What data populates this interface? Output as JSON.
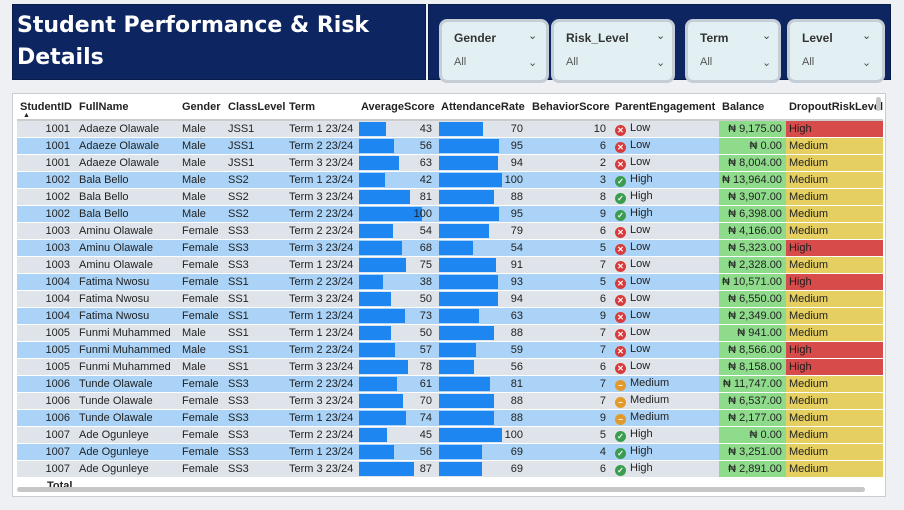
{
  "report": {
    "title": "Student Performance & Risk Details",
    "more_options": "..."
  },
  "slicers": [
    {
      "title": "Gender",
      "value": "All"
    },
    {
      "title": "Risk_Level",
      "value": "All"
    },
    {
      "title": "Term",
      "value": "All"
    },
    {
      "title": "Level",
      "value": "All"
    }
  ],
  "table": {
    "columns": [
      "StudentID",
      "FullName",
      "Gender",
      "ClassLevel",
      "Term",
      "AverageScore",
      "AttendanceRate",
      "BehaviorScore",
      "ParentEngagement",
      "Balance",
      "DropoutRiskLevel"
    ],
    "sorted_column": "StudentID",
    "rows": [
      {
        "StudentID": "1001",
        "FullName": "Adaeze Olawale",
        "Gender": "Male",
        "ClassLevel": "JSS1",
        "Term": "Term 1 23/24",
        "AverageScore": 43,
        "AttendanceRate": 70,
        "BehaviorScore": "10",
        "ParentEngagement": "Low",
        "Balance": "₦ 9,175.00",
        "DropoutRiskLevel": "High"
      },
      {
        "StudentID": "1001",
        "FullName": "Adaeze Olawale",
        "Gender": "Male",
        "ClassLevel": "JSS1",
        "Term": "Term 2 23/24",
        "AverageScore": 56,
        "AttendanceRate": 95,
        "BehaviorScore": "6",
        "ParentEngagement": "Low",
        "Balance": "₦ 0.00",
        "DropoutRiskLevel": "Medium"
      },
      {
        "StudentID": "1001",
        "FullName": "Adaeze Olawale",
        "Gender": "Male",
        "ClassLevel": "JSS1",
        "Term": "Term 3 23/24",
        "AverageScore": 63,
        "AttendanceRate": 94,
        "BehaviorScore": "2",
        "ParentEngagement": "Low",
        "Balance": "₦ 8,004.00",
        "DropoutRiskLevel": "Medium"
      },
      {
        "StudentID": "1002",
        "FullName": "Bala Bello",
        "Gender": "Male",
        "ClassLevel": "SS2",
        "Term": "Term 1 23/24",
        "AverageScore": 42,
        "AttendanceRate": 100,
        "BehaviorScore": "3",
        "ParentEngagement": "High",
        "Balance": "₦ 13,964.00",
        "DropoutRiskLevel": "Medium"
      },
      {
        "StudentID": "1002",
        "FullName": "Bala Bello",
        "Gender": "Male",
        "ClassLevel": "SS2",
        "Term": "Term 3 23/24",
        "AverageScore": 81,
        "AttendanceRate": 88,
        "BehaviorScore": "8",
        "ParentEngagement": "High",
        "Balance": "₦ 3,907.00",
        "DropoutRiskLevel": "Medium"
      },
      {
        "StudentID": "1002",
        "FullName": "Bala Bello",
        "Gender": "Male",
        "ClassLevel": "SS2",
        "Term": "Term 2 23/24",
        "AverageScore": 100,
        "AttendanceRate": 95,
        "BehaviorScore": "9",
        "ParentEngagement": "High",
        "Balance": "₦ 6,398.00",
        "DropoutRiskLevel": "Medium"
      },
      {
        "StudentID": "1003",
        "FullName": "Aminu Olawale",
        "Gender": "Female",
        "ClassLevel": "SS3",
        "Term": "Term 2 23/24",
        "AverageScore": 54,
        "AttendanceRate": 79,
        "BehaviorScore": "6",
        "ParentEngagement": "Low",
        "Balance": "₦ 4,166.00",
        "DropoutRiskLevel": "Medium"
      },
      {
        "StudentID": "1003",
        "FullName": "Aminu Olawale",
        "Gender": "Female",
        "ClassLevel": "SS3",
        "Term": "Term 3 23/24",
        "AverageScore": 68,
        "AttendanceRate": 54,
        "BehaviorScore": "5",
        "ParentEngagement": "Low",
        "Balance": "₦ 5,323.00",
        "DropoutRiskLevel": "High"
      },
      {
        "StudentID": "1003",
        "FullName": "Aminu Olawale",
        "Gender": "Female",
        "ClassLevel": "SS3",
        "Term": "Term 1 23/24",
        "AverageScore": 75,
        "AttendanceRate": 91,
        "BehaviorScore": "7",
        "ParentEngagement": "Low",
        "Balance": "₦ 2,328.00",
        "DropoutRiskLevel": "Medium"
      },
      {
        "StudentID": "1004",
        "FullName": "Fatima Nwosu",
        "Gender": "Female",
        "ClassLevel": "SS1",
        "Term": "Term 2 23/24",
        "AverageScore": 38,
        "AttendanceRate": 93,
        "BehaviorScore": "5",
        "ParentEngagement": "Low",
        "Balance": "₦ 10,571.00",
        "DropoutRiskLevel": "High"
      },
      {
        "StudentID": "1004",
        "FullName": "Fatima Nwosu",
        "Gender": "Female",
        "ClassLevel": "SS1",
        "Term": "Term 3 23/24",
        "AverageScore": 50,
        "AttendanceRate": 94,
        "BehaviorScore": "6",
        "ParentEngagement": "Low",
        "Balance": "₦ 6,550.00",
        "DropoutRiskLevel": "Medium"
      },
      {
        "StudentID": "1004",
        "FullName": "Fatima Nwosu",
        "Gender": "Female",
        "ClassLevel": "SS1",
        "Term": "Term 1 23/24",
        "AverageScore": 73,
        "AttendanceRate": 63,
        "BehaviorScore": "9",
        "ParentEngagement": "Low",
        "Balance": "₦ 2,349.00",
        "DropoutRiskLevel": "Medium"
      },
      {
        "StudentID": "1005",
        "FullName": "Funmi Muhammed",
        "Gender": "Male",
        "ClassLevel": "SS1",
        "Term": "Term 1 23/24",
        "AverageScore": 50,
        "AttendanceRate": 88,
        "BehaviorScore": "7",
        "ParentEngagement": "Low",
        "Balance": "₦ 941.00",
        "DropoutRiskLevel": "Medium"
      },
      {
        "StudentID": "1005",
        "FullName": "Funmi Muhammed",
        "Gender": "Male",
        "ClassLevel": "SS1",
        "Term": "Term 2 23/24",
        "AverageScore": 57,
        "AttendanceRate": 59,
        "BehaviorScore": "7",
        "ParentEngagement": "Low",
        "Balance": "₦ 8,566.00",
        "DropoutRiskLevel": "High"
      },
      {
        "StudentID": "1005",
        "FullName": "Funmi Muhammed",
        "Gender": "Male",
        "ClassLevel": "SS1",
        "Term": "Term 3 23/24",
        "AverageScore": 78,
        "AttendanceRate": 56,
        "BehaviorScore": "6",
        "ParentEngagement": "Low",
        "Balance": "₦ 8,158.00",
        "DropoutRiskLevel": "High"
      },
      {
        "StudentID": "1006",
        "FullName": "Tunde Olawale",
        "Gender": "Female",
        "ClassLevel": "SS3",
        "Term": "Term 2 23/24",
        "AverageScore": 61,
        "AttendanceRate": 81,
        "BehaviorScore": "7",
        "ParentEngagement": "Medium",
        "Balance": "₦ 11,747.00",
        "DropoutRiskLevel": "Medium"
      },
      {
        "StudentID": "1006",
        "FullName": "Tunde Olawale",
        "Gender": "Female",
        "ClassLevel": "SS3",
        "Term": "Term 3 23/24",
        "AverageScore": 70,
        "AttendanceRate": 88,
        "BehaviorScore": "7",
        "ParentEngagement": "Medium",
        "Balance": "₦ 6,537.00",
        "DropoutRiskLevel": "Medium"
      },
      {
        "StudentID": "1006",
        "FullName": "Tunde Olawale",
        "Gender": "Female",
        "ClassLevel": "SS3",
        "Term": "Term 1 23/24",
        "AverageScore": 74,
        "AttendanceRate": 88,
        "BehaviorScore": "9",
        "ParentEngagement": "Medium",
        "Balance": "₦ 2,177.00",
        "DropoutRiskLevel": "Medium"
      },
      {
        "StudentID": "1007",
        "FullName": "Ade Ogunleye",
        "Gender": "Female",
        "ClassLevel": "SS3",
        "Term": "Term 2 23/24",
        "AverageScore": 45,
        "AttendanceRate": 100,
        "BehaviorScore": "5",
        "ParentEngagement": "High",
        "Balance": "₦ 0.00",
        "DropoutRiskLevel": "Medium"
      },
      {
        "StudentID": "1007",
        "FullName": "Ade Ogunleye",
        "Gender": "Female",
        "ClassLevel": "SS3",
        "Term": "Term 1 23/24",
        "AverageScore": 56,
        "AttendanceRate": 69,
        "BehaviorScore": "4",
        "ParentEngagement": "High",
        "Balance": "₦ 3,251.00",
        "DropoutRiskLevel": "Medium"
      },
      {
        "StudentID": "1007",
        "FullName": "Ade Ogunleye",
        "Gender": "Female",
        "ClassLevel": "SS3",
        "Term": "Term 3 23/24",
        "AverageScore": 87,
        "AttendanceRate": 69,
        "BehaviorScore": "6",
        "ParentEngagement": "High",
        "Balance": "₦ 2,891.00",
        "DropoutRiskLevel": "Medium"
      }
    ],
    "total_label": "Total"
  },
  "colors": {
    "banner": "#0d2661",
    "bar": "#1e86f0",
    "balance_bg": "#8fdb8c",
    "risk_high": "#d84b4b",
    "risk_medium": "#e4cf60",
    "engagement_low": "#d93a3a",
    "engagement_high": "#3a9d4e",
    "engagement_medium": "#e39a2b"
  },
  "icons": {
    "dropdown": "chevron-down-icon",
    "engagement_low": "x-circle-icon",
    "engagement_high": "check-circle-icon",
    "engagement_medium": "minus-circle-icon",
    "sort": "sort-ascending-icon"
  }
}
